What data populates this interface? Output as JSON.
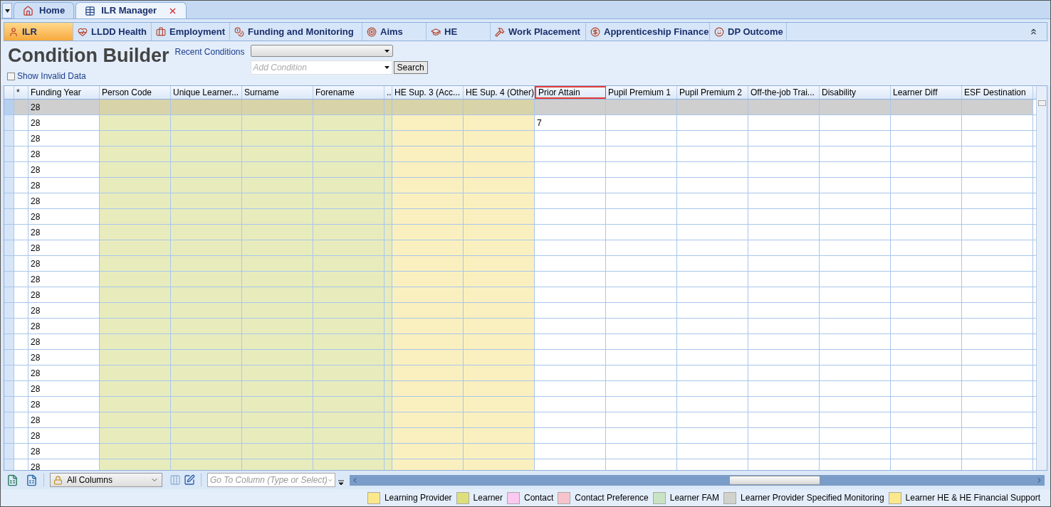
{
  "doc_tabs": [
    {
      "label": "Home",
      "selected": false
    },
    {
      "label": "ILR Manager",
      "selected": true
    }
  ],
  "ribbon_tabs": [
    {
      "label": "ILR",
      "selected": true
    },
    {
      "label": "LLDD Health",
      "selected": false
    },
    {
      "label": "Employment",
      "selected": false
    },
    {
      "label": "Funding and Monitoring",
      "selected": false
    },
    {
      "label": "Aims",
      "selected": false
    },
    {
      "label": "HE",
      "selected": false
    },
    {
      "label": "Work Placement",
      "selected": false
    },
    {
      "label": "Apprenticeship Finance",
      "selected": false
    },
    {
      "label": "DP Outcome",
      "selected": false
    }
  ],
  "title": "Condition Builder",
  "recent_conditions_label": "Recent Conditions",
  "add_condition": {
    "placeholder": "Add Condition"
  },
  "search_button": "Search",
  "show_invalid": {
    "label": "Show Invalid Data",
    "checked": false
  },
  "table": {
    "columns": [
      {
        "label": "*"
      },
      {
        "label": "Funding Year"
      },
      {
        "label": "Person Code",
        "color": "#e8ecbc"
      },
      {
        "label": "Unique Learner...",
        "color": "#e8ecbc"
      },
      {
        "label": "Surname",
        "color": "#e8ecbc"
      },
      {
        "label": "Forename",
        "color": "#e8ecbc"
      },
      {
        "label": "..",
        "color": "#e8ecbc"
      },
      {
        "label": "HE Sup. 3 (Acc...",
        "color": "#faf0bf"
      },
      {
        "label": "HE Sup. 4 (Other)",
        "color": "#faf0bf"
      },
      {
        "label": "Prior Attain",
        "selected": true
      },
      {
        "label": "Pupil Premium 1"
      },
      {
        "label": "Pupil Premium 2"
      },
      {
        "label": "Off-the-job Trai..."
      },
      {
        "label": "Disability"
      },
      {
        "label": "Learner Diff"
      },
      {
        "label": "ESF Destination"
      }
    ],
    "rows": [
      {
        "selected": true,
        "funding_year": "28"
      },
      {
        "selected": false,
        "funding_year": "28",
        "prior_attain": "7"
      },
      {
        "selected": false,
        "funding_year": "28"
      },
      {
        "selected": false,
        "funding_year": "28"
      },
      {
        "selected": false,
        "funding_year": "28"
      },
      {
        "selected": false,
        "funding_year": "28"
      },
      {
        "selected": false,
        "funding_year": "28"
      },
      {
        "selected": false,
        "funding_year": "28"
      },
      {
        "selected": false,
        "funding_year": "28"
      },
      {
        "selected": false,
        "funding_year": "28"
      },
      {
        "selected": false,
        "funding_year": "28"
      },
      {
        "selected": false,
        "funding_year": "28"
      },
      {
        "selected": false,
        "funding_year": "28"
      },
      {
        "selected": false,
        "funding_year": "28"
      },
      {
        "selected": false,
        "funding_year": "28"
      },
      {
        "selected": false,
        "funding_year": "28"
      },
      {
        "selected": false,
        "funding_year": "28"
      },
      {
        "selected": false,
        "funding_year": "28"
      },
      {
        "selected": false,
        "funding_year": "28"
      },
      {
        "selected": false,
        "funding_year": "28"
      },
      {
        "selected": false,
        "funding_year": "28"
      },
      {
        "selected": false,
        "funding_year": "28"
      },
      {
        "selected": false,
        "funding_year": "28"
      },
      {
        "selected": false,
        "funding_year": "28"
      }
    ]
  },
  "column_filter": "All Columns",
  "go_to_column": {
    "placeholder": "Go To Column (Type or Select)"
  },
  "legend": [
    {
      "label": "Learning Provider",
      "color": "#fbe88a"
    },
    {
      "label": "Learner",
      "color": "#dde07a"
    },
    {
      "label": "Contact",
      "color": "#fbc8f0"
    },
    {
      "label": "Contact Preference",
      "color": "#f8c4cc"
    },
    {
      "label": "Learner FAM",
      "color": "#c8e4c4"
    },
    {
      "label": "Learner Provider Specified Monitoring",
      "color": "#d2d2cc"
    },
    {
      "label": "Learner HE & HE Financial Support",
      "color": "#fbe88a"
    }
  ]
}
